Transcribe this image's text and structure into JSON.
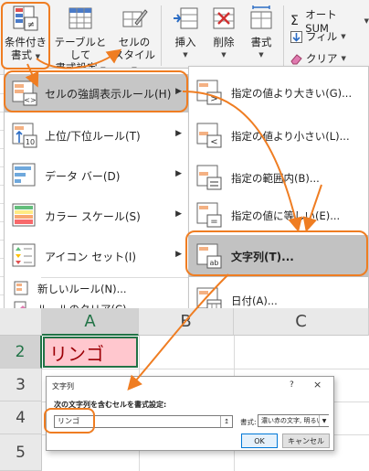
{
  "ribbon": {
    "conditional_format": {
      "line1": "条件付き",
      "line2": "書式"
    },
    "format_as_table": {
      "line1": "テーブルとして",
      "line2": "書式設定"
    },
    "cell_style": {
      "line1": "セルの",
      "line2": "スタイル"
    },
    "insert": "挿入",
    "delete": "削除",
    "format": "書式",
    "autosum": "オート SUM",
    "fill": "フィル",
    "clear": "クリア"
  },
  "menu": {
    "items": [
      {
        "label": "セルの強調表示ルール(H)",
        "has_submenu": true
      },
      {
        "label": "上位/下位ルール(T)",
        "has_submenu": true
      },
      {
        "label": "データ バー(D)",
        "has_submenu": true
      },
      {
        "label": "カラー スケール(S)",
        "has_submenu": true
      },
      {
        "label": "アイコン セット(I)",
        "has_submenu": true
      },
      {
        "label": "新しいルール(N)..."
      },
      {
        "label": "ルールのクリア(C)"
      }
    ]
  },
  "submenu": {
    "items": [
      {
        "label": "指定の値より大きい(G)..."
      },
      {
        "label": "指定の値より小さい(L)..."
      },
      {
        "label": "指定の範囲内(B)..."
      },
      {
        "label": "指定の値に等しい(E)..."
      },
      {
        "label": "文字列(T)..."
      },
      {
        "label": "日付(A)..."
      }
    ]
  },
  "sheet": {
    "columns": [
      "A",
      "B",
      "C"
    ],
    "rows": [
      "2",
      "3",
      "4",
      "5"
    ],
    "cell_a2": "リンゴ"
  },
  "dialog": {
    "title": "文字列",
    "help": "?",
    "close": "×",
    "heading": "次の文字列を含むセルを書式設定:",
    "input_value": "リンゴ",
    "format_label": "書式:",
    "format_value": "濃い赤の文字, 明るい赤の背景",
    "ok": "OK",
    "cancel": "キャンセル"
  },
  "colors": {
    "accent_orange": "#ef7d22",
    "excel_green": "#217346",
    "highlight_fill": "#ffc7ce",
    "highlight_text": "#9c0006"
  }
}
